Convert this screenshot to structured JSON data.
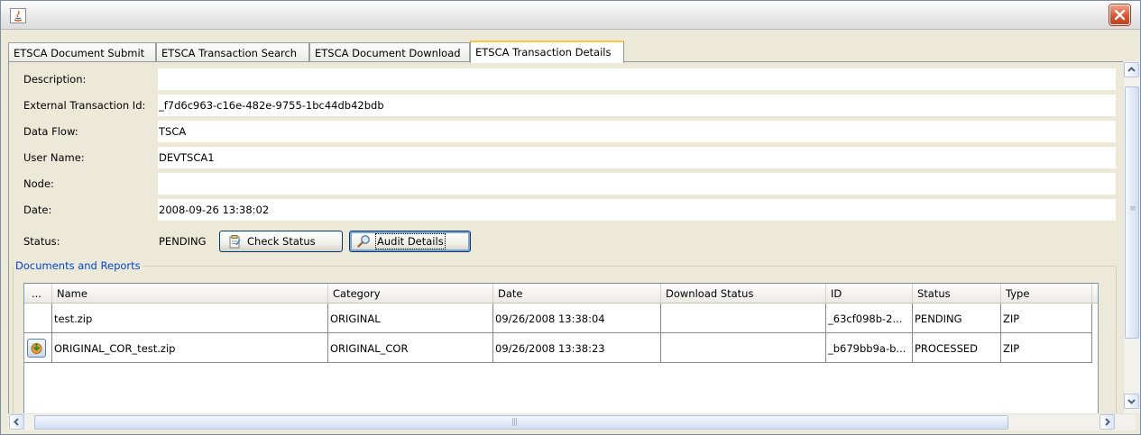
{
  "window": {
    "title": ""
  },
  "tabs": [
    {
      "label": "ETSCA Document Submit",
      "active": false
    },
    {
      "label": "ETSCA Transaction Search",
      "active": false
    },
    {
      "label": "ETSCA Document Download",
      "active": false
    },
    {
      "label": "ETSCA Transaction Details",
      "active": true
    }
  ],
  "form": {
    "description": {
      "label": "Description:",
      "value": ""
    },
    "external_id": {
      "label": "External Transaction Id:",
      "value": "_f7d6c963-c16e-482e-9755-1bc44db42bdb"
    },
    "data_flow": {
      "label": "Data Flow:",
      "value": "TSCA"
    },
    "user_name": {
      "label": "User Name:",
      "value": "DEVTSCA1"
    },
    "node": {
      "label": "Node:",
      "value": ""
    },
    "date": {
      "label": "Date:",
      "value": "2008-09-26 13:38:02"
    },
    "status": {
      "label": "Status:",
      "value": "PENDING"
    }
  },
  "buttons": {
    "check_status": "Check Status",
    "audit_details": "Audit Details"
  },
  "documents": {
    "group_title": "Documents and Reports",
    "columns": [
      "...",
      "Name",
      "Category",
      "Date",
      "Download Status",
      "ID",
      "Status",
      "Type"
    ],
    "rows": [
      {
        "has_icon": false,
        "name": "test.zip",
        "category": "ORIGINAL",
        "date": "09/26/2008 13:38:04",
        "download_status": "",
        "id": "_63cf098b-2...",
        "status": "PENDING",
        "type": "ZIP"
      },
      {
        "has_icon": true,
        "name": "ORIGINAL_COR_test.zip",
        "category": "ORIGINAL_COR",
        "date": "09/26/2008 13:38:23",
        "download_status": "",
        "id": "_b679bb9a-b...",
        "status": "PROCESSED",
        "type": "ZIP"
      }
    ]
  },
  "colors": {
    "tab_active_accent": "#ffc73c",
    "group_title": "#0046d5",
    "close_button": "#d9542f"
  }
}
